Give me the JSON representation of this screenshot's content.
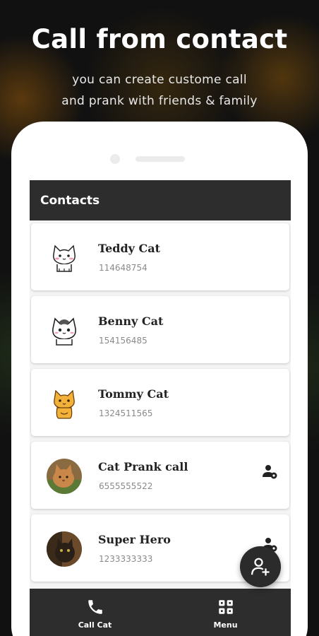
{
  "promo": {
    "headline": "Call from contact",
    "subline_1": "you can create custome call",
    "subline_2": "and prank with friends & family"
  },
  "app": {
    "title": "Contacts",
    "contacts": [
      {
        "name": "Teddy Cat",
        "number": "114648754",
        "avatar": "white-cat-sticker",
        "has_contact_icon": false
      },
      {
        "name": "Benny Cat",
        "number": "154156485",
        "avatar": "grey-cat-sticker",
        "has_contact_icon": false
      },
      {
        "name": "Tommy Cat",
        "number": "1324511565",
        "avatar": "orange-cat-sticker",
        "has_contact_icon": false
      },
      {
        "name": "Cat Prank call",
        "number": "6555555522",
        "avatar": "cat-photo",
        "has_contact_icon": true
      },
      {
        "name": "Super Hero",
        "number": "1233333333",
        "avatar": "cat-photo-dark",
        "has_contact_icon": true
      }
    ],
    "fab_icon": "add-person-icon",
    "bottom_nav": [
      {
        "label": "Call Cat",
        "icon": "phone-icon"
      },
      {
        "label": "Menu",
        "icon": "grid-menu-icon"
      }
    ]
  },
  "colors": {
    "appbar": "#2d2d2d",
    "background": "#111111",
    "card": "#ffffff"
  }
}
